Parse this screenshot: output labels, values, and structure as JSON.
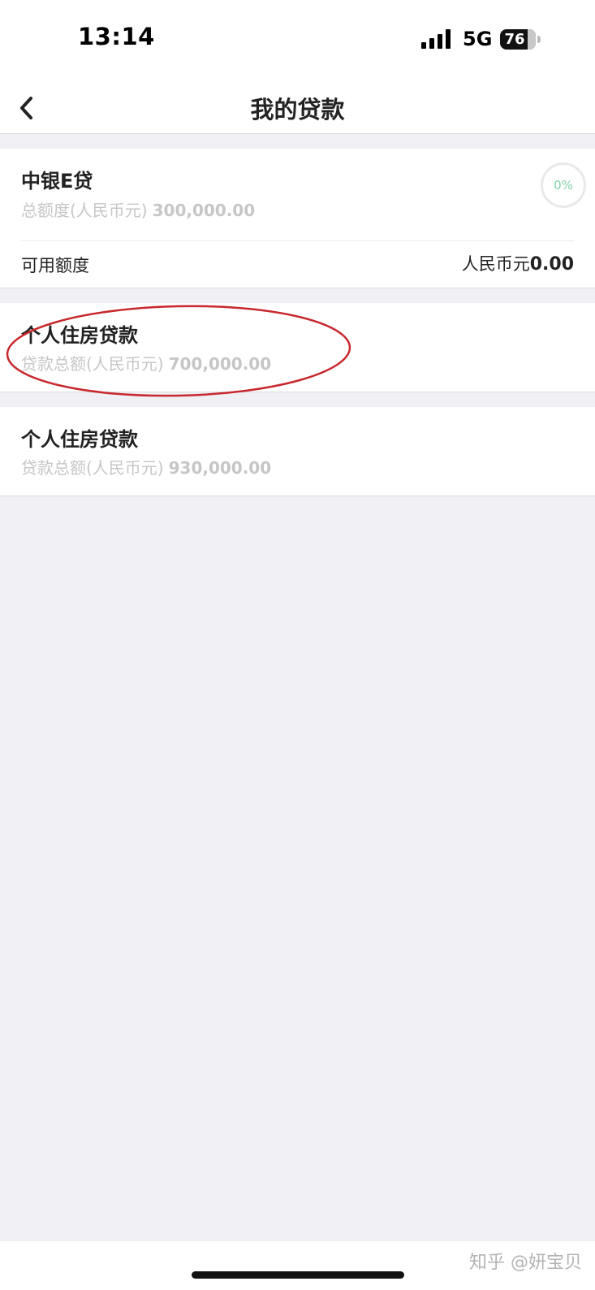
{
  "status_bar": {
    "time": "13:14",
    "network": "5G",
    "battery": "76"
  },
  "nav": {
    "title": "我的贷款"
  },
  "cards": [
    {
      "name": "中银E贷",
      "sub_label": "总额度(人民币元)",
      "sub_value": "300,000.00",
      "progress_label": "0%",
      "progress": 0,
      "available_label": "可用额度",
      "available_currency": "人民币元",
      "available_value": "0.00"
    },
    {
      "name": "个人住房贷款",
      "sub_label": "贷款总额(人民币元)",
      "sub_value": "700,000.00"
    },
    {
      "name": "个人住房贷款",
      "sub_label": "贷款总额(人民币元)",
      "sub_value": "930,000.00"
    }
  ],
  "annotation": {
    "color": "#c8282e"
  },
  "watermark": "知乎 @妍宝贝"
}
